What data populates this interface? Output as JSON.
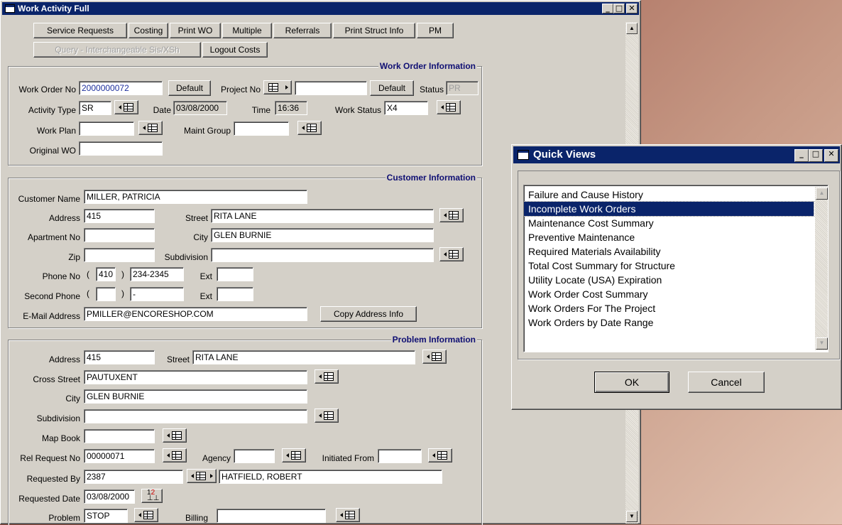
{
  "main_window": {
    "title": "Work Activity Full",
    "toolbar": {
      "service_requests": "Service Requests",
      "costing": "Costing",
      "print_wo": "Print WO",
      "multiple": "Multiple",
      "referrals": "Referrals",
      "print_struct_info": "Print Struct Info",
      "pm": "PM",
      "query_interchangeable": "Query - Interchangeable Sis/XSh",
      "logout_costs": "Logout Costs"
    },
    "work_order": {
      "title": "Work Order Information",
      "work_order_no_label": "Work Order No",
      "work_order_no": "2000000072",
      "default_label": "Default",
      "project_no_label": "Project No",
      "project_no": "",
      "default2_label": "Default",
      "status_label": "Status",
      "status": "PR",
      "activity_type_label": "Activity Type",
      "activity_type": "SR",
      "date_label": "Date",
      "date": "03/08/2000",
      "time_label": "Time",
      "time": "16:36",
      "work_status_label": "Work Status",
      "work_status": "X4",
      "work_plan_label": "Work Plan",
      "work_plan": "",
      "maint_group_label": "Maint Group",
      "maint_group": "",
      "original_wo_label": "Original WO",
      "original_wo": ""
    },
    "customer": {
      "title": "Customer Information",
      "customer_name_label": "Customer Name",
      "customer_name": "MILLER, PATRICIA",
      "address_label": "Address",
      "address": "415",
      "street_label": "Street",
      "street": "RITA LANE",
      "apartment_label": "Apartment No",
      "apartment": "",
      "city_label": "City",
      "city": "GLEN BURNIE",
      "zip_label": "Zip",
      "zip": "",
      "subdivision_label": "Subdivision",
      "subdivision": "",
      "phone_label": "Phone No",
      "phone_open": "(",
      "phone_area": "410",
      "phone_close": ")",
      "phone_number": "234-2345",
      "ext_label": "Ext",
      "ext": "",
      "second_phone_label": "Second Phone",
      "second_open": "(",
      "second_area": "",
      "second_close": ")",
      "second_number": "-",
      "ext2_label": "Ext",
      "ext2": "",
      "email_label": "E-Mail Address",
      "email": "PMILLER@ENCORESHOP.COM",
      "copy_address_label": "Copy Address Info"
    },
    "problem": {
      "title": "Problem Information",
      "address_label": "Address",
      "address": "415",
      "street_label": "Street",
      "street": "RITA LANE",
      "cross_street_label": "Cross Street",
      "cross_street": "PAUTUXENT",
      "city_label": "City",
      "city": "GLEN BURNIE",
      "subdivision_label": "Subdivision",
      "subdivision": "",
      "map_book_label": "Map Book",
      "map_book": "",
      "rel_request_label": "Rel Request No",
      "rel_request": "00000071",
      "agency_label": "Agency",
      "agency": "",
      "initiated_from_label": "Initiated From",
      "initiated_from": "",
      "requested_by_label": "Requested By",
      "requested_by": "2387",
      "requested_by_name": "HATFIELD, ROBERT",
      "requested_date_label": "Requested Date",
      "requested_date": "03/08/2000",
      "problem_label": "Problem",
      "problem": "STOP",
      "billing_label": "Billing",
      "billing": ""
    }
  },
  "quick_views": {
    "title": "Quick Views",
    "items": [
      "Failure and Cause History",
      "Incomplete Work Orders",
      "Maintenance Cost Summary",
      "Preventive Maintenance",
      "Required Materials Availability",
      "Total Cost Summary for Structure",
      "Utility Locate (USA) Expiration",
      "Work Order Cost Summary",
      "Work Orders For The Project",
      "Work Orders by Date Range"
    ],
    "selected_index": 1,
    "ok_label": "OK",
    "cancel_label": "Cancel"
  }
}
